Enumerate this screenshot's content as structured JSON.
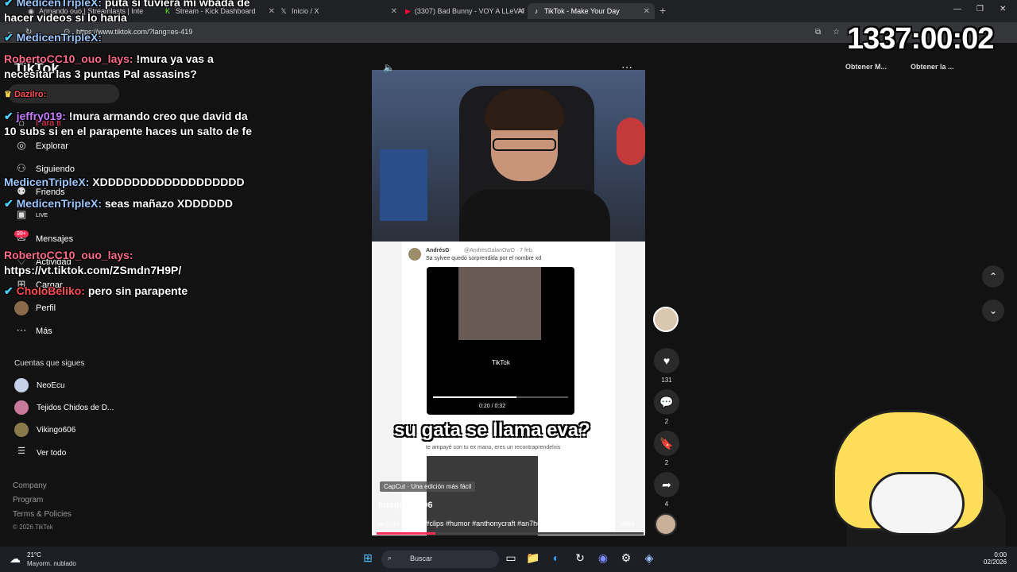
{
  "browser": {
    "tabs": [
      {
        "label": "Armando ouo | Streamlasts | Inte",
        "icon": "streamlasts-icon"
      },
      {
        "label": "Stream - Kick Dashboard",
        "icon": "kick-icon"
      },
      {
        "label": "Inicio / X",
        "icon": "x-icon"
      },
      {
        "label": "(3307) Bad Bunny - VOY A LLeVAR",
        "icon": "youtube-icon"
      },
      {
        "label": "TikTok - Make Your Day",
        "icon": "tiktok-icon"
      }
    ],
    "url": "https://www.tiktok.com/?lang=es-419"
  },
  "sidebar": {
    "logo": "TikTok",
    "items": [
      {
        "label": "Para ti",
        "icon": "home-icon"
      },
      {
        "label": "Explorar",
        "icon": "compass-icon"
      },
      {
        "label": "Siguiendo",
        "icon": "following-icon"
      },
      {
        "label": "Friends",
        "icon": "friends-icon"
      },
      {
        "label": "LIVE",
        "icon": "live-icon"
      },
      {
        "label": "Mensajes",
        "icon": "messages-icon"
      },
      {
        "label": "Actividad",
        "icon": "activity-icon"
      },
      {
        "label": "Cargar",
        "icon": "upload-icon"
      },
      {
        "label": "Perfil",
        "icon": "profile-avatar"
      },
      {
        "label": "Más",
        "icon": "more-icon"
      }
    ],
    "messages_badge": "99+",
    "following_title": "Cuentas que sigues",
    "following": [
      {
        "label": "NeoEcu",
        "color": "#c8d0e8"
      },
      {
        "label": "Tejidos Chidos de D...",
        "color": "#c87a9a"
      },
      {
        "label": "Vikingo606",
        "color": "#8a7a4a"
      },
      {
        "label": "Ver todo",
        "color": ""
      }
    ],
    "footer": [
      "Company",
      "Program",
      "Terms & Policies"
    ],
    "copyright": "© 2026 TikTok"
  },
  "video": {
    "tweet": {
      "author": "AndrésG",
      "handle": "@AndresGalanOwO · 7 feb.",
      "text": "Sa sylvee quedó sorprendida por el nombre xd",
      "player_logo": "TikTok",
      "player_time": "0:20 / 0:32",
      "player_progress": 0.62,
      "reply_text": "te ampayé con tu ex mano, eres un recontraprendelvis"
    },
    "subtitle": "su gata se llama eva?",
    "capcut": "CapCut · Una edición más fácil",
    "author": "huequero_96",
    "description": "la gata de craft#clips #humor #anthonycraft #an7hony96 ...",
    "more_label": "más",
    "progress": 0.22
  },
  "actions": {
    "likes": "131",
    "comments": "2",
    "saves": "2",
    "shares": "4"
  },
  "header_right": {
    "get_app_1": "Obtener M...",
    "get_app_2": "Obtener la ..."
  },
  "chat": [
    {
      "user": "MedicenTripleX:",
      "msg": "puta si tuviera mi wbada de hacer videos si lo haria",
      "ucls": "u1"
    },
    {
      "user": "MedicenTripleX:",
      "msg": "",
      "ucls": "u1"
    },
    {
      "user": "RobertoCC10_ouo_lays:",
      "msg": "!mura ya vas a necesitar las 3 puntas Pal assasins?",
      "ucls": "u2"
    },
    {
      "user": "Dazilro:",
      "msg": "",
      "ucls": "u4"
    },
    {
      "user": "jeffry019:",
      "msg": "!mura armando creo que david da 10 subs si en el parapente haces un salto de fe",
      "ucls": "u3"
    },
    {
      "user": "MedicenTripleX:",
      "msg": "XDDDDDDDDDDDDDDDDDD",
      "ucls": "u1"
    },
    {
      "user": "MedicenTripleX:",
      "msg": "seas mañazo XDDDDDD",
      "ucls": "u1"
    },
    {
      "user": "RobertoCC10_ouo_lays:",
      "msg": "https://vt.tiktok.com/ZSmdn7H9P/",
      "ucls": "u2"
    },
    {
      "user": "ChoIoBeliko:",
      "msg": "pero sin parapente",
      "ucls": "u4"
    }
  ],
  "overlay": {
    "timer": "1337:00:02"
  },
  "taskbar": {
    "temperature": "21°C",
    "weather": "Mayorm. nublado",
    "search_placeholder": "Buscar",
    "time": "0:00",
    "date": "02/2026"
  }
}
